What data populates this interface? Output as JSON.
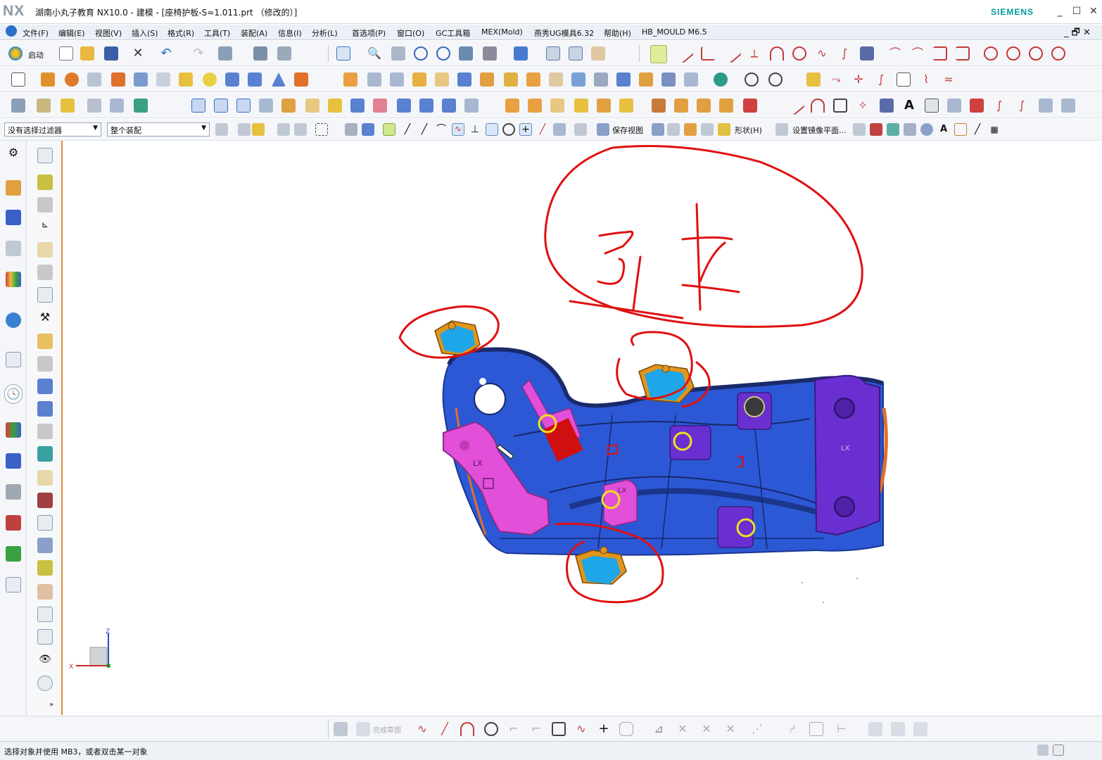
{
  "window": {
    "logo": "NX",
    "title": "湖南小丸子教育 NX10.0 - 建模 - [座椅护板-S=1.011.prt （修改的）]",
    "brand": "SIEMENS",
    "minimize": "_",
    "maximize": "☐",
    "close": "✕"
  },
  "menu": {
    "items": [
      "文件(F)",
      "编辑(E)",
      "视图(V)",
      "插入(S)",
      "格式(R)",
      "工具(T)",
      "装配(A)",
      "信息(I)",
      "分析(L)",
      "首选项(P)",
      "窗口(O)",
      "GC工具箱",
      "MEX(Mold)",
      "燕秀UG模具6.32",
      "帮助(H)",
      "HB_MOULD M6.5"
    ],
    "restore": "_ 🗗 ✕"
  },
  "toolbar": {
    "start_label": "启动",
    "selection_filter": "没有选择过滤器",
    "assembly_scope": "整个装配",
    "save_view": "保存视图",
    "shape": "形状(H)",
    "mirror_plane": "设置镜像平面..."
  },
  "bottom_toolbar": {
    "finish_sketch": "完成草图"
  },
  "status": {
    "message": "选择对象并使用 MB3，或者双击某一对象"
  },
  "triad": {
    "z": "Z",
    "x": "X"
  },
  "part": {
    "labels": [
      "LX",
      "LX",
      "LX"
    ]
  },
  "colors": {
    "part_body": "#2c58d6",
    "part_pink": "#e24fd8",
    "part_purple": "#6a2fd0",
    "part_orange": "#e0951c",
    "part_cyan": "#1ea6e8",
    "annotation_red": "#e01010"
  }
}
